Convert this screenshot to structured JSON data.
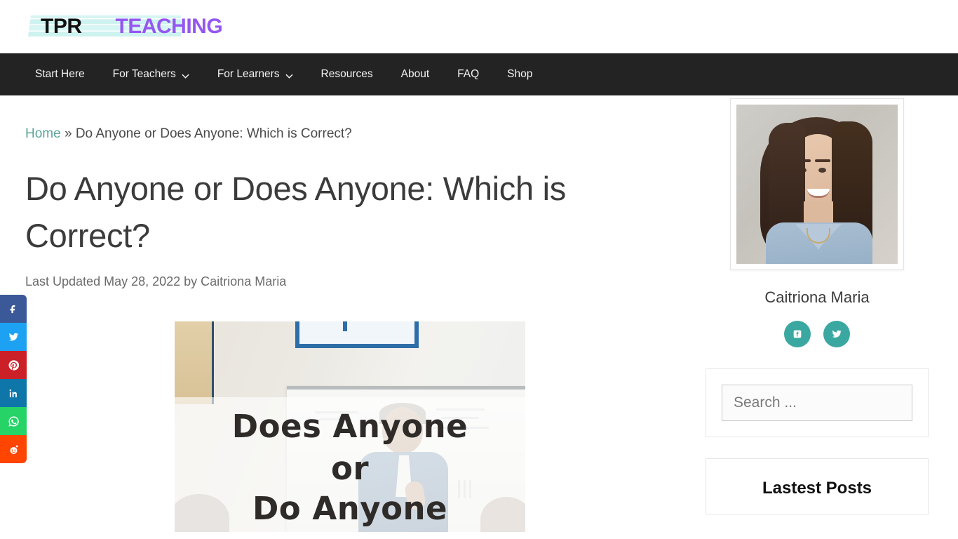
{
  "site": {
    "logo_primary": "TPR",
    "logo_secondary": "TEACHING",
    "brand_purple": "#9457f0",
    "brand_mint": "#cdf2ef",
    "nav_bg": "#232323",
    "accent_teal": "#5ba39c"
  },
  "nav": {
    "items": [
      {
        "label": "Start Here",
        "has_dropdown": false
      },
      {
        "label": "For Teachers",
        "has_dropdown": true
      },
      {
        "label": "For Learners",
        "has_dropdown": true
      },
      {
        "label": "Resources",
        "has_dropdown": false
      },
      {
        "label": "About",
        "has_dropdown": false
      },
      {
        "label": "FAQ",
        "has_dropdown": false
      },
      {
        "label": "Shop",
        "has_dropdown": false
      }
    ]
  },
  "breadcrumb": {
    "home": "Home",
    "separator": "»",
    "current": "Do Anyone or Does Anyone: Which is Correct?"
  },
  "article": {
    "title": "Do Anyone or Does Anyone: Which is Correct?",
    "meta": "Last Updated May 28, 2022 by Caitriona Maria",
    "meta_prefix": "Last Updated",
    "date": "May 28, 2022",
    "author": "Caitriona Maria",
    "featured_image": {
      "overlay_line1": "Does Anyone",
      "overlay_line2": "or",
      "overlay_line3": "Do Anyone",
      "alt": "classroom-whiteboard-presenter"
    }
  },
  "share_rail": {
    "items": [
      {
        "name": "facebook",
        "glyph": "f",
        "color": "#3b5998"
      },
      {
        "name": "twitter",
        "glyph": "t",
        "color": "#1da1f2"
      },
      {
        "name": "pinterest",
        "glyph": "p",
        "color": "#cb2027"
      },
      {
        "name": "linkedin",
        "glyph": "in",
        "color": "#0e76a8"
      },
      {
        "name": "whatsapp",
        "glyph": "w",
        "color": "#25d366"
      },
      {
        "name": "reddit",
        "glyph": "r",
        "color": "#ff4500"
      }
    ]
  },
  "sidebar": {
    "author_card": {
      "name": "Caitriona Maria",
      "socials": [
        {
          "name": "facebook",
          "color": "#3aa8a0"
        },
        {
          "name": "twitter",
          "color": "#3aa8a0"
        }
      ]
    },
    "search": {
      "placeholder": "Search ...",
      "value": ""
    },
    "latest_posts": {
      "title": "Lastest Posts"
    }
  }
}
